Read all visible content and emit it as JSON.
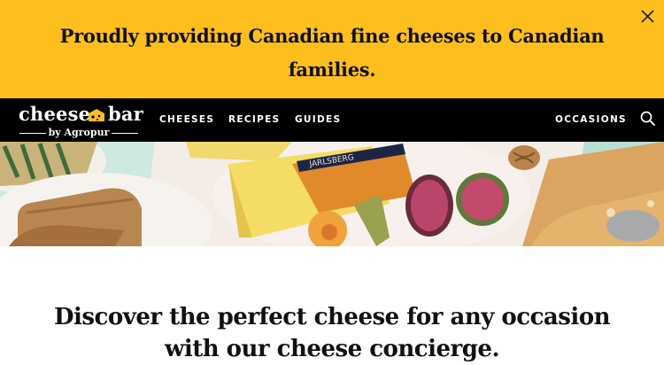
{
  "banner": {
    "message": "Proudly providing Canadian fine cheeses to Canadian families.",
    "close_icon": "close-icon",
    "background_color": "#fdbf1d"
  },
  "header": {
    "logo": {
      "word_left": "cheese",
      "word_right": "bar",
      "tagline": "by Agropur",
      "icon": "cheese-wedge-icon"
    },
    "nav": {
      "cheeses": "CHEESES",
      "recipes": "RECIPES",
      "guides": "GUIDES",
      "occasions": "OCCASIONS"
    },
    "search_icon": "search-icon",
    "background_color": "#000000"
  },
  "hero": {
    "image": "cheese-board-photo",
    "cheese_label": "JARLSBERG"
  },
  "main": {
    "headline_line1": "Discover the perfect cheese for any occasion",
    "headline_line2": "with our cheese concierge."
  }
}
